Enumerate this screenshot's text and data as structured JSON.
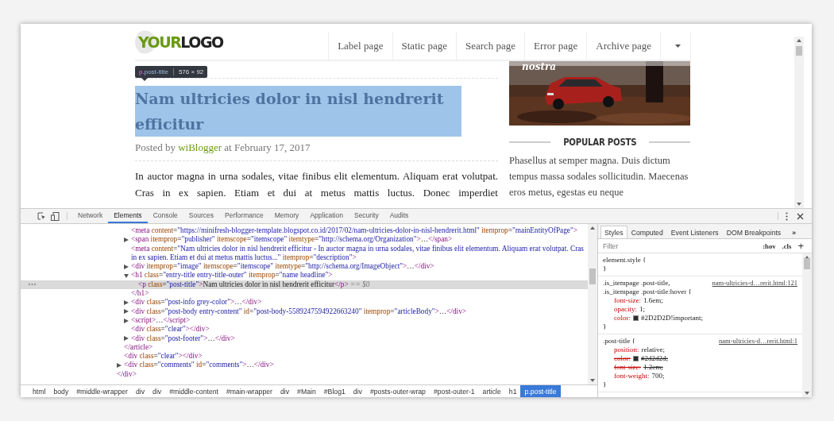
{
  "site": {
    "logo": {
      "first": "YOUR",
      "second": "LOGO"
    },
    "nav": [
      "Label page",
      "Static page",
      "Search page",
      "Error page",
      "Archive page"
    ],
    "post": {
      "highlighted": true,
      "tooltip": {
        "tag": "p",
        "class_name": ".post-title",
        "size": "576 × 92"
      },
      "title": "Nam ultricies dolor in nisl hendrerit efficitur",
      "byline": {
        "prefix": "Posted by",
        "author": "wiBlogger",
        "suffix": "at February 17, 2017"
      },
      "body": "In auctor magna in urna sodales, vitae finibus elit elementum. Aliquam erat volutpat. Cras in ex sapien. Etiam et dui at metus mattis luctus. Donec imperdiet"
    },
    "sidebar": {
      "image_caption": "nostra",
      "heading": "POPULAR POSTS",
      "snippet": "Phasellus at semper magna. Duis dictum tempus massa sodales sollicitudin. Maecenas eros metus, egestas eu neque"
    }
  },
  "devtools": {
    "tabs": [
      {
        "label": "Network",
        "selected": false
      },
      {
        "label": "Elements",
        "selected": true
      },
      {
        "label": "Console",
        "selected": false
      },
      {
        "label": "Sources",
        "selected": false
      },
      {
        "label": "Performance",
        "selected": false
      },
      {
        "label": "Memory",
        "selected": false
      },
      {
        "label": "Application",
        "selected": false
      },
      {
        "label": "Security",
        "selected": false
      },
      {
        "label": "Audits",
        "selected": false
      }
    ],
    "elements_tree": [
      {
        "selected": false,
        "close": "</div>",
        "children": [
          {
            "selected": false,
            "close": "</article>",
            "children": [
              {
                "selected": false,
                "line": "<meta content=\"https://minifresh-blogger-template.blogspot.co.id/2017/02/nam-ultricies-dolor-in-nisl-hendrerit.html\" itemprop=\"mainEntityOfPage\">"
              },
              {
                "selected": false,
                "expanded": false,
                "line": "<span itemprop=\"publisher\" itemscope=\"itemscope\" itemtype=\"http://schema.org/Organization\">…</span>"
              },
              {
                "selected": false,
                "line": "<meta content=\"Nam ultricies dolor in nisl hendrerit efficitur - In auctor magna in urna sodales, vitae finibus elit elementum. Aliquam erat volutpat. Cras in ex sapien. Etiam et dui at metus mattis luctus...\" itemprop=\"description\">"
              },
              {
                "selected": false,
                "expanded": false,
                "line": "<div itemprop=\"image\" itemscope=\"itemscope\" itemtype=\"http://schema.org/ImageObject\">…</div>"
              },
              {
                "selected": false,
                "expanded": true,
                "line": "<h1 class=\"entry-title entry-title-outer\" itemprop=\"name headline\">",
                "close": "</h1>",
                "children": [
                  {
                    "selected": true,
                    "line": "<p class=\"post-title\">Nam ultricies dolor in nisl hendrerit efficitur</p>",
                    "marker": "== $0"
                  }
                ]
              },
              {
                "selected": false,
                "expanded": false,
                "line": "<div class=\"post-info grey-color\">…</div>"
              },
              {
                "selected": false,
                "expanded": false,
                "line": "<div class=\"post-body entry-content\" id=\"post-body-5589247594922663240\" itemprop=\"articleBody\">…</div>"
              },
              {
                "selected": false,
                "expanded": false,
                "line": "<script>…</script>"
              },
              {
                "selected": false,
                "line": "<div class=\"clear\"></div>"
              },
              {
                "selected": false,
                "expanded": false,
                "line": "<div class=\"post-footer\">…</div>"
              }
            ]
          },
          {
            "selected": false,
            "line": "<div class=\"clear\"></div>"
          },
          {
            "selected": false,
            "expanded": false,
            "line": "<div class=\"comments\" id=\"comments\">…</div>"
          }
        ]
      }
    ],
    "breadcrumbs": [
      {
        "label": "html",
        "selected": false
      },
      {
        "label": "body",
        "selected": false
      },
      {
        "label": "#middle-wrapper",
        "selected": false
      },
      {
        "label": "div",
        "selected": false
      },
      {
        "label": "div",
        "selected": false
      },
      {
        "label": "#middle-content",
        "selected": false
      },
      {
        "label": "#main-wrapper",
        "selected": false
      },
      {
        "label": "div",
        "selected": false
      },
      {
        "label": "#Main",
        "selected": false
      },
      {
        "label": "#Blog1",
        "selected": false
      },
      {
        "label": "div",
        "selected": false
      },
      {
        "label": "#posts-outer-wrap",
        "selected": false
      },
      {
        "label": "#post-outer-1",
        "selected": false
      },
      {
        "label": "article",
        "selected": false
      },
      {
        "label": "h1",
        "selected": false
      },
      {
        "label": "p.post-title",
        "selected": true
      }
    ],
    "styles": {
      "tabs": [
        {
          "label": "Styles",
          "selected": true
        },
        {
          "label": "Computed",
          "selected": false
        },
        {
          "label": "Event Listeners",
          "selected": false
        },
        {
          "label": "DOM Breakpoints",
          "selected": false
        }
      ],
      "more": "»",
      "filter": {
        "placeholder": "Filter"
      },
      "buttons": [
        ":hov",
        ".cls",
        "+"
      ],
      "rules": [
        {
          "selector": "element.style {",
          "close": "}"
        },
        {
          "selector": ".is_itempage .post-title, .is_itempage .post-title:hover {",
          "source": "nam-ultricies-d…rerit.html:121",
          "close": "}",
          "props": [
            {
              "name": "font-size:",
              "value": "1.6em;",
              "struck": false
            },
            {
              "name": "opacity:",
              "value": "1;",
              "struck": false
            },
            {
              "name": "color:",
              "value": "#2D2D2D!important;",
              "color": "#2d2d2d",
              "struck": false
            }
          ]
        },
        {
          "selector": ".post-title {",
          "source": "nam-ultricies-d…rerit.html:1",
          "close": "}",
          "props": [
            {
              "name": "position:",
              "value": "relative;",
              "struck": false
            },
            {
              "name": "color:",
              "value": "#2d2d2d;",
              "color": "#2d2d2d",
              "struck": true
            },
            {
              "name": "font-size:",
              "value": "1.2em;",
              "struck": true
            },
            {
              "name": "font-weight:",
              "value": "700;",
              "struck": false
            }
          ]
        }
      ]
    }
  }
}
